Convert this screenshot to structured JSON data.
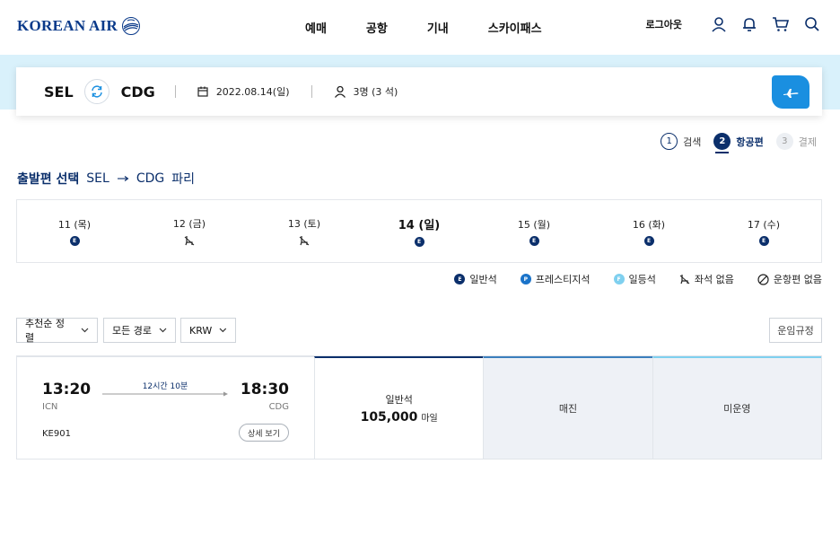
{
  "header": {
    "logo_text": "KOREAN AIR",
    "nav": [
      "예매",
      "공항",
      "기내",
      "스카이패스"
    ],
    "logout_label": "로그아웃",
    "icons": [
      "user-icon",
      "bell-icon",
      "cart-icon",
      "search-icon"
    ]
  },
  "search": {
    "origin": "SEL",
    "destination": "CDG",
    "date": "2022.08.14(일)",
    "passengers": "3명 (3 석)"
  },
  "steps": [
    {
      "num": "1",
      "label": "검색",
      "state": "done"
    },
    {
      "num": "2",
      "label": "항공편",
      "state": "current"
    },
    {
      "num": "3",
      "label": "결제",
      "state": "pending"
    }
  ],
  "section": {
    "title": "출발편 선택",
    "route_from": "SEL",
    "route_to": "CDG",
    "city": "파리"
  },
  "dates": [
    {
      "label": "11 (목)",
      "status": "economy",
      "badge": "E"
    },
    {
      "label": "12 (금)",
      "status": "no-seat",
      "badge": ""
    },
    {
      "label": "13 (토)",
      "status": "no-seat",
      "badge": ""
    },
    {
      "label": "14 (일)",
      "status": "economy",
      "badge": "E",
      "selected": true
    },
    {
      "label": "15 (월)",
      "status": "economy",
      "badge": "E"
    },
    {
      "label": "16 (화)",
      "status": "economy",
      "badge": "E"
    },
    {
      "label": "17 (수)",
      "status": "economy",
      "badge": "E"
    }
  ],
  "legend": [
    {
      "badge": "E",
      "label": "일반석",
      "color": "#0b2f6b"
    },
    {
      "badge": "P",
      "label": "프레스티지석",
      "color": "#1a73c9"
    },
    {
      "badge": "F",
      "label": "일등석",
      "color": "#7fd0ef"
    },
    {
      "badge": "",
      "label": "좌석 없음",
      "icon": "no-seat-icon"
    },
    {
      "badge": "",
      "label": "운항편 없음",
      "icon": "no-flight-icon"
    }
  ],
  "filters": {
    "sort": "추천순 정렬",
    "route": "모든 경로",
    "currency": "KRW",
    "fare_rule": "운임규정"
  },
  "flight": {
    "dep_time": "13:20",
    "dep_airport": "ICN",
    "arr_time": "18:30",
    "arr_airport": "CDG",
    "duration": "12시간 10분",
    "flight_no": "KE901",
    "detail_label": "상세 보기",
    "economy_label": "일반석",
    "economy_price": "105,000",
    "economy_unit": "마일",
    "prestige_status": "매진",
    "first_status": "미운영"
  },
  "colors": {
    "brand_navy": "#0b2f6b",
    "accent_blue": "#1a8fe0",
    "band_bg": "#d9f1fb"
  }
}
